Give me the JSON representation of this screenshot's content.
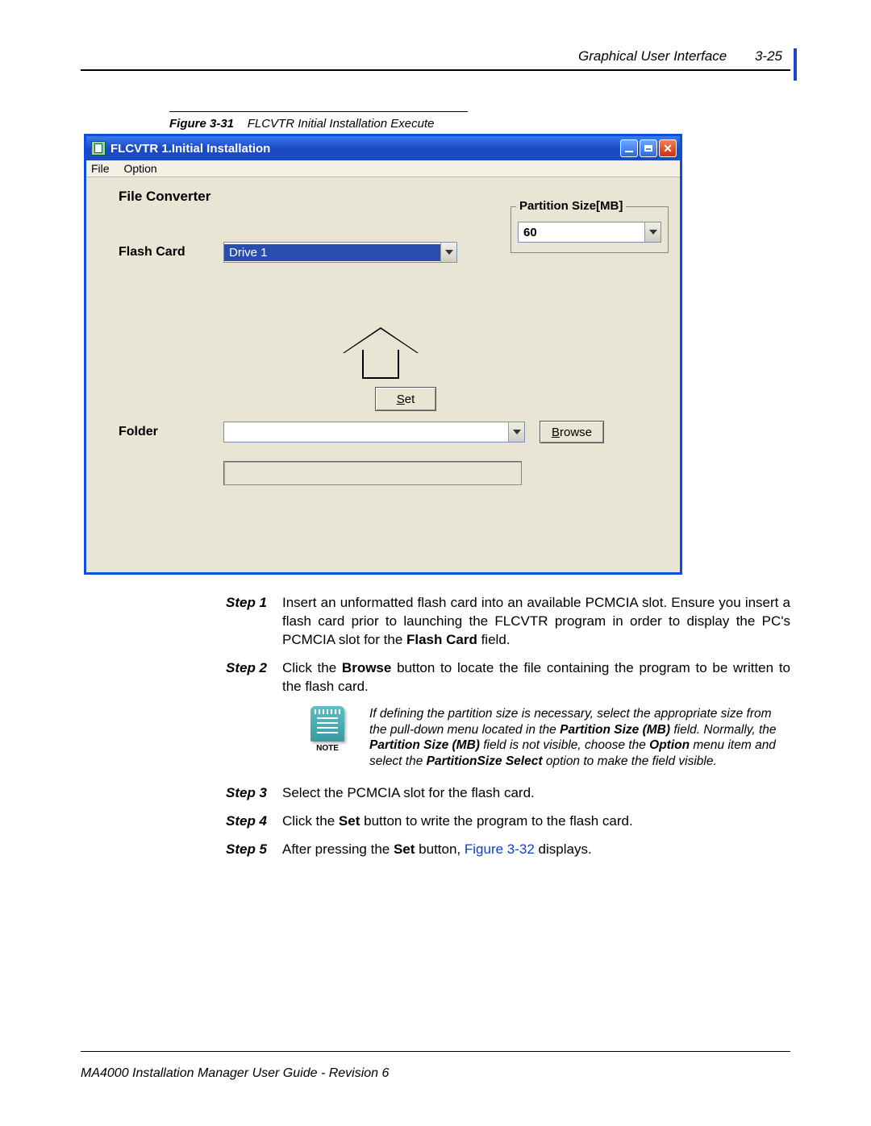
{
  "header": {
    "section": "Graphical User Interface",
    "page": "3-25"
  },
  "figure": {
    "num": "Figure 3-31",
    "title": "FLCVTR Initial Installation Execute"
  },
  "window": {
    "title": "FLCVTR  1.Initial Installation",
    "menu": {
      "file": "File",
      "option": "Option"
    },
    "fc_title": "File Converter",
    "flash_label": "Flash Card",
    "flash_value": "Drive 1",
    "partition_legend": "Partition Size[MB]",
    "partition_value": "60",
    "set_label": "Set",
    "folder_label": "Folder",
    "folder_value": "",
    "browse_label": "Browse",
    "status_value": ""
  },
  "steps": {
    "s1_label": "Step  1",
    "s1_body_a": "Insert an unformatted flash card into an available PCMCIA slot. Ensure you insert a flash card prior to launching the FLCVTR program in order to display the PC's PCMCIA slot for the ",
    "s1_bold": "Flash Card",
    "s1_body_b": " field.",
    "s2_label": "Step  2",
    "s2_body_a": "Click the ",
    "s2_bold": "Browse",
    "s2_body_b": " button to locate the file containing the program to be written to the flash card.",
    "note_label": "NOTE",
    "note_a": "If defining the partition size is necessary, select the appropriate size from the pull-down menu located in the ",
    "note_b1": "Partition Size (MB)",
    "note_b": " field. Normally, the ",
    "note_b2": "Partition Size (MB)",
    "note_c": " field is not visible, choose the ",
    "note_b3": "Option",
    "note_d": " menu item and select the ",
    "note_b4": "PartitionSize Select",
    "note_e": " option to make the field visible.",
    "s3_label": "Step  3",
    "s3_body": "Select the PCMCIA slot for the flash card.",
    "s4_label": "Step  4",
    "s4_body_a": "Click the ",
    "s4_bold": "Set",
    "s4_body_b": " button to write the program to the flash card.",
    "s5_label": "Step  5",
    "s5_body_a": "After pressing the ",
    "s5_bold": "Set",
    "s5_body_b": " button, ",
    "s5_link": "Figure 3-32",
    "s5_body_c": " displays."
  },
  "footer": "MA4000 Installation Manager User Guide - Revision 6"
}
